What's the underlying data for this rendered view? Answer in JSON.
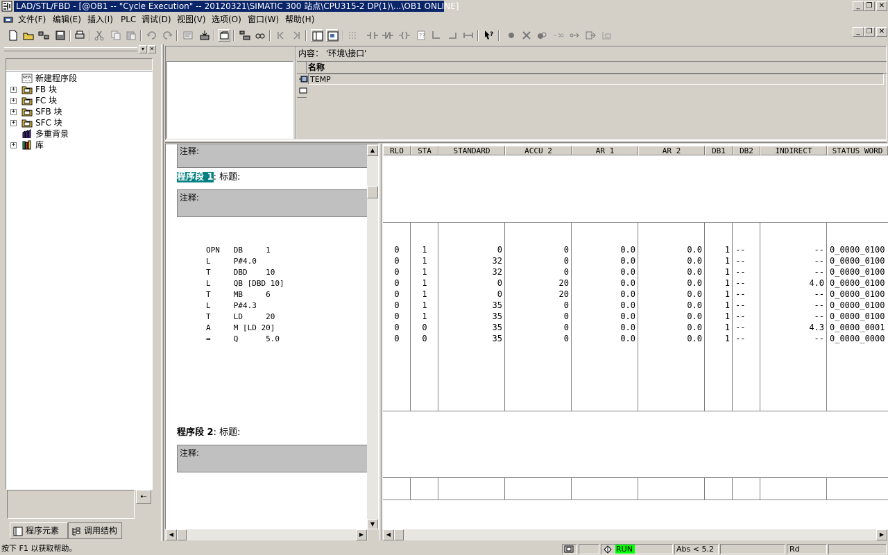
{
  "window": {
    "title": "LAD/STL/FBD - [@OB1 -- \"Cycle Execution\" -- 20120321\\SIMATIC 300 站点\\CPU315-2 DP(1)\\...\\OB1 ONLINE]"
  },
  "menu": [
    {
      "label": "文件(F)"
    },
    {
      "label": "编辑(E)"
    },
    {
      "label": "插入(I)"
    },
    {
      "label": "PLC"
    },
    {
      "label": "调试(D)"
    },
    {
      "label": "视图(V)"
    },
    {
      "label": "选项(O)"
    },
    {
      "label": "窗口(W)"
    },
    {
      "label": "帮助(H)"
    }
  ],
  "tree": {
    "items": [
      {
        "label": "新建程序段",
        "icon": "new-network-icon"
      },
      {
        "label": "FB 块",
        "icon": "block-folder-icon"
      },
      {
        "label": "FC 块",
        "icon": "block-folder-icon"
      },
      {
        "label": "SFB 块",
        "icon": "block-folder-icon"
      },
      {
        "label": "SFC 块",
        "icon": "block-folder-icon"
      },
      {
        "label": "多重背景",
        "icon": "multi-instance-icon"
      },
      {
        "label": "库",
        "icon": "library-icon"
      }
    ]
  },
  "tabs": {
    "program_elements": "程序元素",
    "call_structure": "调用结构"
  },
  "interface": {
    "content_label": "内容：  '环境\\接口'",
    "column_name": "名称",
    "row_temp": "TEMP"
  },
  "code": {
    "comment_label": "注释:",
    "network1_label": "程序段",
    "network1_num": "1",
    "network1_title": ": 标题:",
    "network2_label": "程序段",
    "network2_num": "2",
    "network2_title": ": 标题:",
    "lines": [
      "OPN   DB     1",
      "L     P#4.0",
      "T     DBD    10",
      "L     QB [DBD 10]",
      "T     MB     6",
      "L     P#4.3",
      "T     LD     20",
      "A     M [LD 20]",
      "=     Q      5.0"
    ]
  },
  "status_table": {
    "columns": [
      "RLO",
      "STA",
      "STANDARD",
      "ACCU 2",
      "AR 1",
      "AR 2",
      "DB1",
      "DB2",
      "INDIRECT",
      "STATUS WORD"
    ],
    "rows": [
      [
        "0",
        "1",
        "0",
        "0",
        "0.0",
        "0.0",
        "1",
        "--",
        "--",
        "0_0000_0100"
      ],
      [
        "0",
        "1",
        "32",
        "0",
        "0.0",
        "0.0",
        "1",
        "--",
        "--",
        "0_0000_0100"
      ],
      [
        "0",
        "1",
        "32",
        "0",
        "0.0",
        "0.0",
        "1",
        "--",
        "--",
        "0_0000_0100"
      ],
      [
        "0",
        "1",
        "0",
        "20",
        "0.0",
        "0.0",
        "1",
        "--",
        "4.0",
        "0_0000_0100"
      ],
      [
        "0",
        "1",
        "0",
        "20",
        "0.0",
        "0.0",
        "1",
        "--",
        "--",
        "0_0000_0100"
      ],
      [
        "0",
        "1",
        "35",
        "0",
        "0.0",
        "0.0",
        "1",
        "--",
        "--",
        "0_0000_0100"
      ],
      [
        "0",
        "1",
        "35",
        "0",
        "0.0",
        "0.0",
        "1",
        "--",
        "--",
        "0_0000_0100"
      ],
      [
        "0",
        "0",
        "35",
        "0",
        "0.0",
        "0.0",
        "1",
        "--",
        "4.3",
        "0_0000_0001"
      ],
      [
        "0",
        "0",
        "35",
        "0",
        "0.0",
        "0.0",
        "1",
        "--",
        "--",
        "0_0000_0000"
      ]
    ]
  },
  "statusbar": {
    "help": "按下 F1 以获取帮助。",
    "run": "RUN",
    "address": "Abs < 5.2",
    "mode": "Rd"
  },
  "colors": {
    "title_bg": "#0a246a",
    "run_bg": "#00ff00",
    "network_highlight": "#008080"
  }
}
